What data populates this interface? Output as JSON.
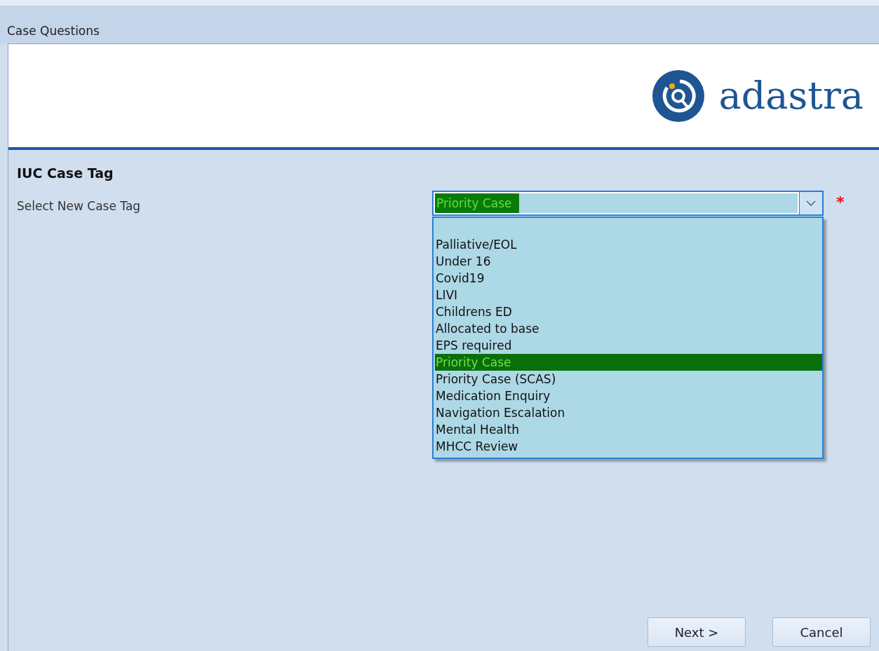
{
  "window": {
    "title": "Case Questions"
  },
  "logo": {
    "text": "adastra"
  },
  "section": {
    "title": "IUC Case Tag"
  },
  "field": {
    "label": "Select New Case Tag",
    "value": "Priority Case",
    "required_mark": "*",
    "expanded": true
  },
  "dropdown": {
    "options": [
      {
        "label": "Palliative/EOL",
        "selected": false
      },
      {
        "label": "Under 16",
        "selected": false
      },
      {
        "label": "Covid19",
        "selected": false
      },
      {
        "label": "LIVI",
        "selected": false
      },
      {
        "label": "Childrens ED",
        "selected": false
      },
      {
        "label": "Allocated to base",
        "selected": false
      },
      {
        "label": "EPS required",
        "selected": false
      },
      {
        "label": "Priority Case",
        "selected": true
      },
      {
        "label": "Priority Case (SCAS)",
        "selected": false
      },
      {
        "label": "Medication Enquiry",
        "selected": false
      },
      {
        "label": "Navigation Escalation",
        "selected": false
      },
      {
        "label": "Mental Health",
        "selected": false
      },
      {
        "label": "MHCC Review",
        "selected": false
      }
    ]
  },
  "buttons": [
    {
      "label": "Next >"
    },
    {
      "label": "Cancel"
    }
  ]
}
